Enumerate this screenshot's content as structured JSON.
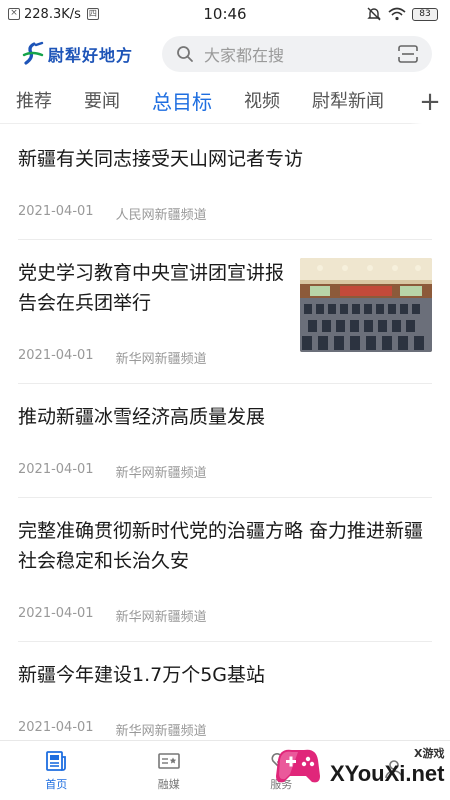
{
  "status_bar": {
    "speed": "228.3K/s",
    "box_glyph": "四",
    "time": "10:46",
    "battery": "83"
  },
  "header": {
    "logo_text": "尉犁好地方",
    "search_placeholder": "大家都在搜"
  },
  "tabs": [
    {
      "label": "推荐"
    },
    {
      "label": "要闻"
    },
    {
      "label": "总目标"
    },
    {
      "label": "视频"
    },
    {
      "label": "尉犁新闻"
    }
  ],
  "active_tab_index": 2,
  "articles": [
    {
      "title": "新疆有关同志接受天山网记者专访",
      "date": "2021-04-01",
      "source": "人民网新疆频道"
    },
    {
      "title": "党史学习教育中央宣讲团宣讲报告会在兵团举行",
      "date": "2021-04-01",
      "source": "新华网新疆频道"
    },
    {
      "title": "推动新疆冰雪经济高质量发展",
      "date": "2021-04-01",
      "source": "新华网新疆频道"
    },
    {
      "title": "完整准确贯彻新时代党的治疆方略 奋力推进新疆社会稳定和长治久安",
      "date": "2021-04-01",
      "source": "新华网新疆频道"
    },
    {
      "title": "新疆今年建设1.7万个5G基站",
      "date": "2021-04-01",
      "source": "新华网新疆频道"
    }
  ],
  "bottom_nav": [
    {
      "label": "首页",
      "icon": "newspaper-icon"
    },
    {
      "label": "融媒",
      "icon": "media-card-icon"
    },
    {
      "label": "服务",
      "icon": "heart-service-icon"
    },
    {
      "label": "",
      "icon": "person-icon"
    }
  ],
  "watermark": {
    "small": "X游戏",
    "big": "XYouXi.net"
  },
  "colors": {
    "accent": "#1e6ee0",
    "logo_blue": "#1d54b8",
    "logo_green": "#16a34a",
    "meta_gray": "#999999"
  }
}
